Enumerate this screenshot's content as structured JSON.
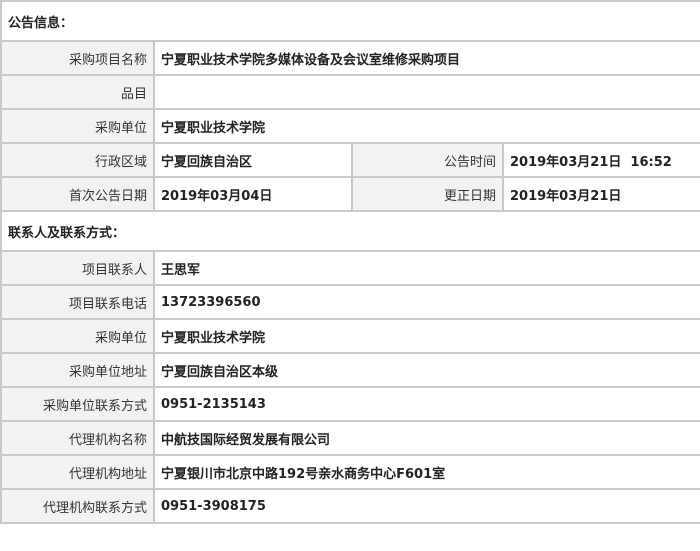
{
  "sections": {
    "announcement": {
      "title": "公告信息：",
      "project_name_label": "采购项目名称",
      "project_name": "宁夏职业技术学院多媒体设备及会议室维修采购项目",
      "item_label": "品目",
      "item_value": "",
      "purchaser_label": "采购单位",
      "purchaser": "宁夏职业技术学院",
      "region_label": "行政区域",
      "region": "宁夏回族自治区",
      "announce_time_label": "公告时间",
      "announce_time": "2019年03月21日  16:52",
      "first_date_label": "首次公告日期",
      "first_date": "2019年03月04日",
      "correction_date_label": "更正日期",
      "correction_date": "2019年03月21日"
    },
    "contacts": {
      "title": "联系人及联系方式：",
      "project_contact_label": "项目联系人",
      "project_contact": "王思军",
      "project_phone_label": "项目联系电话",
      "project_phone": "13723396560",
      "purchaser_label": "采购单位",
      "purchaser": "宁夏职业技术学院",
      "purchaser_address_label": "采购单位地址",
      "purchaser_address": "宁夏回族自治区本级",
      "purchaser_contact_label": "采购单位联系方式",
      "purchaser_contact": "0951-2135143",
      "agency_name_label": "代理机构名称",
      "agency_name": "中航技国际经贸发展有限公司",
      "agency_address_label": "代理机构地址",
      "agency_address": "宁夏银川市北京中路192号亲水商务中心F601室",
      "agency_contact_label": "代理机构联系方式",
      "agency_contact": "0951-3908175"
    }
  }
}
